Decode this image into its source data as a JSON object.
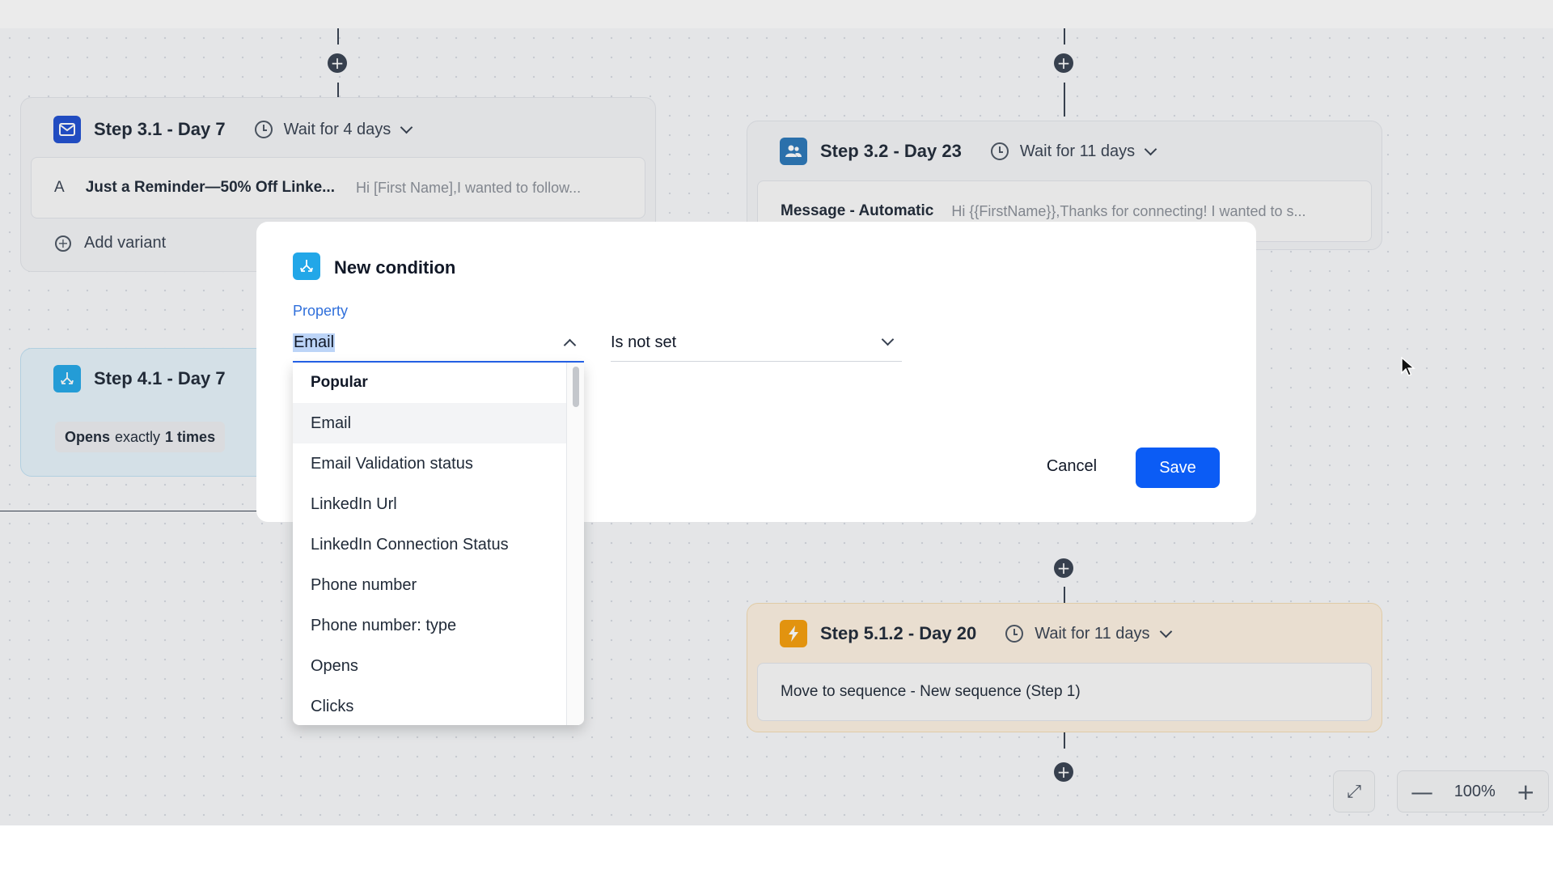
{
  "canvas": {
    "cards": {
      "step31": {
        "title": "Step 3.1 - Day 7",
        "wait": "Wait for 4 days",
        "variant_letter": "A",
        "subject": "Just a Reminder—50% Off Linke...",
        "preview": "Hi [First Name],I wanted to follow...",
        "add_variant": "Add variant"
      },
      "step32": {
        "title": "Step 3.2 - Day 23",
        "wait": "Wait for 11 days",
        "action": "Message - Automatic",
        "preview": "Hi {{FirstName}},Thanks for connecting! I wanted to s..."
      },
      "step41": {
        "title": "Step 4.1 - Day 7",
        "cond_prefix": "Opens",
        "cond_mid": "exactly",
        "cond_suffix": "1 times"
      },
      "step512": {
        "title": "Step 5.1.2 - Day 20",
        "wait": "Wait for 11 days",
        "action": "Move to sequence - New sequence (Step 1)"
      }
    }
  },
  "modal": {
    "title": "New condition",
    "property_label": "Property",
    "property_value": "Email",
    "operator_value": "Is not set",
    "cancel_label": "Cancel",
    "save_label": "Save"
  },
  "dropdown": {
    "group": "Popular",
    "items": [
      "Email",
      "Email Validation status",
      "LinkedIn Url",
      "LinkedIn Connection Status",
      "Phone number",
      "Phone number: type",
      "Opens",
      "Clicks"
    ]
  },
  "zoom": {
    "level": "100%",
    "minus": "—",
    "plus": "+"
  },
  "icons": {
    "plus": "+",
    "fit": "⤢"
  },
  "colors": {
    "accent": "#0b5cf5",
    "email_step": "#1f4fd1",
    "condition_step": "#22a7e8",
    "linkedin_step": "#2a76b8",
    "action_step": "#f59e0b"
  }
}
